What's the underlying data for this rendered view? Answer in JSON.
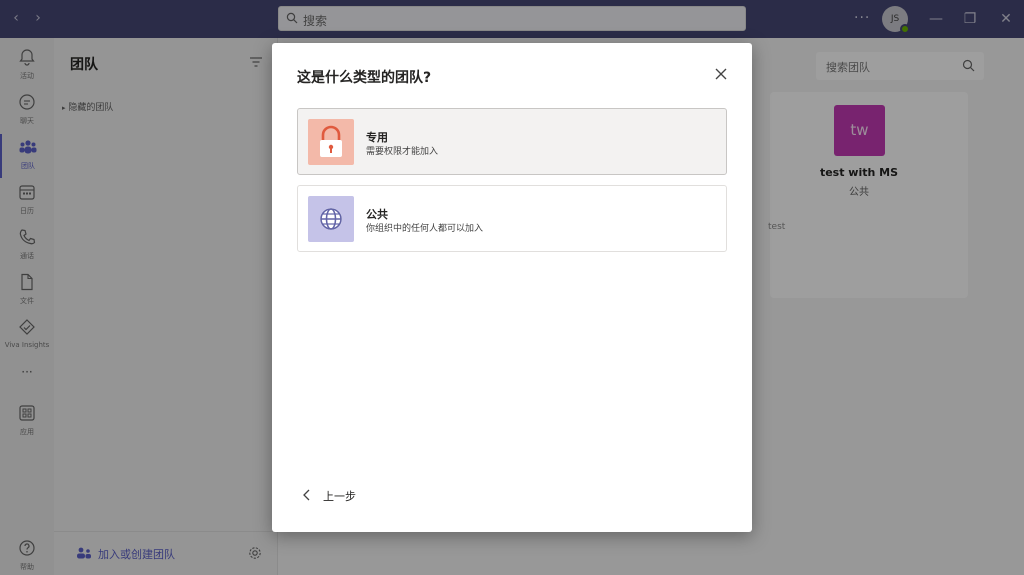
{
  "titlebar": {
    "search_placeholder": "搜索",
    "more": "···",
    "avatar_initials": "JS"
  },
  "rail": {
    "items": [
      {
        "label": "活动",
        "icon": "bell-icon"
      },
      {
        "label": "聊天",
        "icon": "chat-icon"
      },
      {
        "label": "团队",
        "icon": "teams-icon"
      },
      {
        "label": "日历",
        "icon": "calendar-icon"
      },
      {
        "label": "通话",
        "icon": "phone-icon"
      },
      {
        "label": "文件",
        "icon": "file-icon"
      },
      {
        "label": "Viva Insights",
        "icon": "viva-insights-icon"
      },
      {
        "label": "···",
        "icon": "more-icon"
      },
      {
        "label": "应用",
        "icon": "apps-icon"
      },
      {
        "label": "帮助",
        "icon": "help-icon"
      }
    ]
  },
  "teams_panel": {
    "title": "团队",
    "hidden_teams": "隐藏的团队",
    "join_create": "加入或创建团队"
  },
  "main": {
    "search_placeholder": "搜索团队",
    "team": {
      "tile_initials": "tw",
      "name": "test with MS",
      "visibility": "公共",
      "description": "test",
      "tile_color": "#c239b3"
    }
  },
  "dialog": {
    "title": "这是什么类型的团队?",
    "options": [
      {
        "name": "专用",
        "description": "需要权限才能加入",
        "icon": "lock-icon",
        "icon_bg": "#f3b9a9",
        "selected": true
      },
      {
        "name": "公共",
        "description": "你组织中的任何人都可以加入",
        "icon": "globe-icon",
        "icon_bg": "#c5c3e8",
        "selected": false
      }
    ],
    "back_label": "上一步"
  },
  "colors": {
    "titlebar": "#464775",
    "accent": "#5b5fc7"
  }
}
